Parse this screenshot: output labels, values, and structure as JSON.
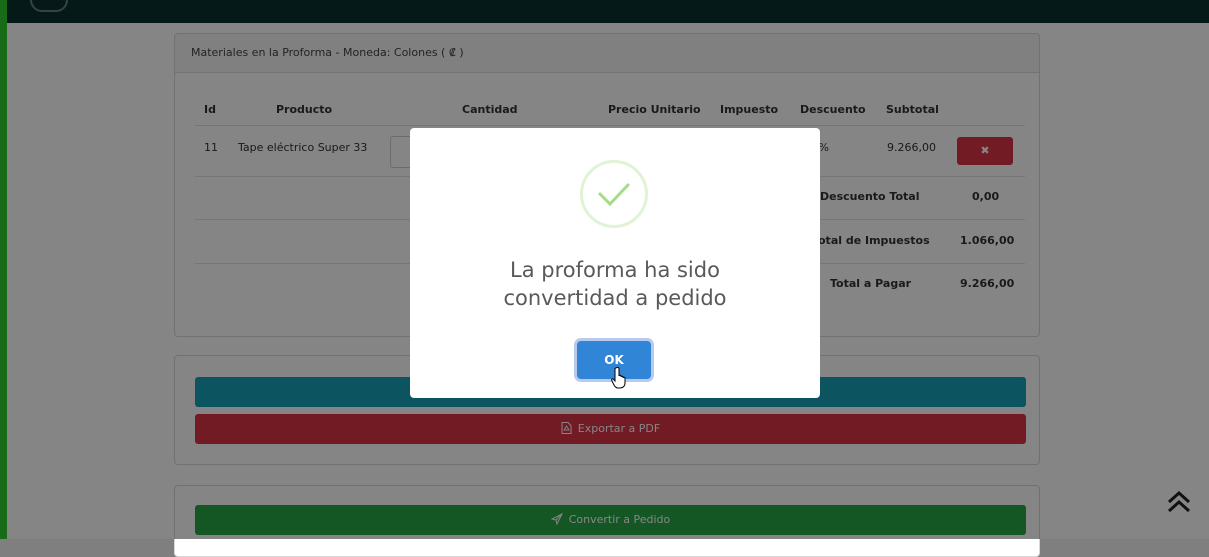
{
  "materials_card": {
    "header": "Materiales en la Proforma - Moneda: Colones ( ₡ )",
    "columns": [
      "Id",
      "Producto",
      "Cantidad",
      "Precio Unitario",
      "Impuesto",
      "Descuento",
      "Subtotal"
    ],
    "rows": [
      {
        "id": "11",
        "producto": "Tape eléctrico Super 33",
        "descuento": "0 %",
        "subtotal": "9.266,00",
        "delete_icon": "✖"
      }
    ],
    "totals": [
      {
        "label": "Descuento Total",
        "value": "0,00"
      },
      {
        "label": "otal de Impuestos",
        "value": "1.066,00"
      },
      {
        "label": "Total a Pagar",
        "value": "9.266,00"
      }
    ]
  },
  "actions": {
    "pdf_label": "Exportar a PDF",
    "pdf_icon": "pdf-file-icon",
    "convert_label": "Convertir a Pedido",
    "convert_icon": "paper-plane-icon"
  },
  "modal": {
    "title_line1": "La proforma ha sido",
    "title_line2": "convertidad a pedido",
    "ok_label": "OK",
    "icon": "success-check-icon"
  },
  "colors": {
    "topbar": "#08302f",
    "teal": "#17a2b8",
    "danger": "#dc3545",
    "success": "#28a745",
    "confirm": "#3085d6"
  }
}
